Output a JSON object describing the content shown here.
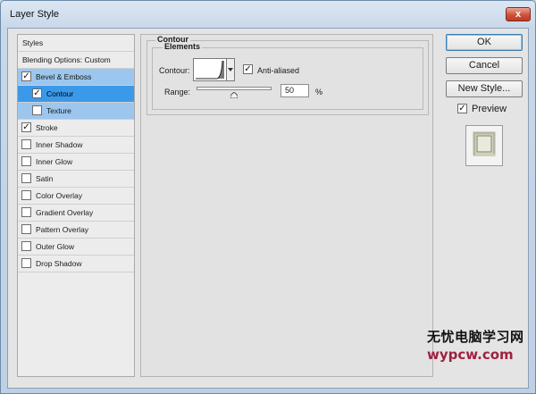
{
  "window": {
    "title": "Layer Style",
    "close_glyph": "x"
  },
  "style_list": {
    "header": "Styles",
    "blending": "Blending Options: Custom",
    "items": [
      {
        "label": "Bevel & Emboss",
        "checked": true,
        "state": "parent-selected"
      },
      {
        "label": "Contour",
        "checked": true,
        "state": "selected"
      },
      {
        "label": "Texture",
        "checked": false,
        "state": "parent-selected"
      },
      {
        "label": "Stroke",
        "checked": true,
        "state": "normal"
      },
      {
        "label": "Inner Shadow",
        "checked": false,
        "state": "normal"
      },
      {
        "label": "Inner Glow",
        "checked": false,
        "state": "normal"
      },
      {
        "label": "Satin",
        "checked": false,
        "state": "normal"
      },
      {
        "label": "Color Overlay",
        "checked": false,
        "state": "normal"
      },
      {
        "label": "Gradient Overlay",
        "checked": false,
        "state": "normal"
      },
      {
        "label": "Pattern Overlay",
        "checked": false,
        "state": "normal"
      },
      {
        "label": "Outer Glow",
        "checked": false,
        "state": "normal"
      },
      {
        "label": "Drop Shadow",
        "checked": false,
        "state": "normal"
      }
    ]
  },
  "contour_panel": {
    "title": "Contour",
    "group": "Elements",
    "contour_label": "Contour:",
    "anti_aliased_label": "Anti-aliased",
    "anti_aliased_checked": true,
    "range_label": "Range:",
    "range_value": "50",
    "range_unit": "%",
    "range_fraction": 0.5
  },
  "buttons": {
    "ok": "OK",
    "cancel": "Cancel",
    "new_style": "New Style..."
  },
  "preview": {
    "label": "Preview",
    "checked": true
  },
  "watermark": {
    "cn": "无忧电脑学习网",
    "url": "wypcw.com"
  },
  "colors": {
    "selected": "#3b99ea",
    "parent_selected": "#9cc6ee",
    "title_bar": "#c8d8ea"
  }
}
